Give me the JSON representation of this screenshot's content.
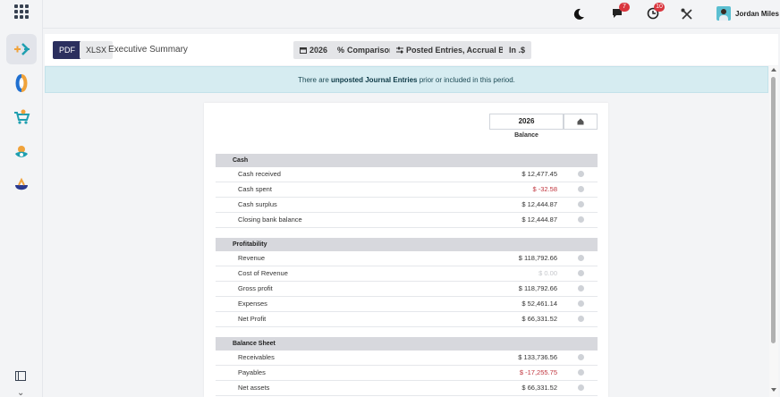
{
  "topbar": {
    "chat_badge": "7",
    "activity_badge": "10",
    "user_name": "Jordan Miles"
  },
  "control": {
    "pdf_label": "PDF",
    "xlsx_label": "XLSX",
    "breadcrumb": "Executive Summary",
    "filters": {
      "date": "2026",
      "comparison": "Comparison",
      "entries": "Posted Entries, Accrual Basis",
      "currency": "In .$"
    }
  },
  "alert": {
    "prefix": "There are ",
    "link": "unposted Journal Entries",
    "suffix": " prior or included in this period."
  },
  "report": {
    "year": "2026",
    "column": "Balance",
    "sections": [
      {
        "title": "Cash",
        "rows": [
          {
            "label": "Cash received",
            "value": "$ 12,477.45",
            "tone": "normal"
          },
          {
            "label": "Cash spent",
            "value": "$ -32.58",
            "tone": "negative"
          },
          {
            "label": "Cash surplus",
            "value": "$ 12,444.87",
            "tone": "normal"
          },
          {
            "label": "Closing bank balance",
            "value": "$ 12,444.87",
            "tone": "normal"
          }
        ]
      },
      {
        "title": "Profitability",
        "rows": [
          {
            "label": "Revenue",
            "value": "$ 118,792.66",
            "tone": "normal"
          },
          {
            "label": "Cost of Revenue",
            "value": "$ 0.00",
            "tone": "muted"
          },
          {
            "label": "Gross profit",
            "value": "$ 118,792.66",
            "tone": "normal"
          },
          {
            "label": "Expenses",
            "value": "$ 52,461.14",
            "tone": "normal"
          },
          {
            "label": "Net Profit",
            "value": "$ 66,331.52",
            "tone": "normal"
          }
        ]
      },
      {
        "title": "Balance Sheet",
        "rows": [
          {
            "label": "Receivables",
            "value": "$ 133,736.56",
            "tone": "normal"
          },
          {
            "label": "Payables",
            "value": "$ -17,255.75",
            "tone": "negative"
          },
          {
            "label": "Net assets",
            "value": "$ 66,331.52",
            "tone": "normal"
          }
        ]
      }
    ]
  }
}
